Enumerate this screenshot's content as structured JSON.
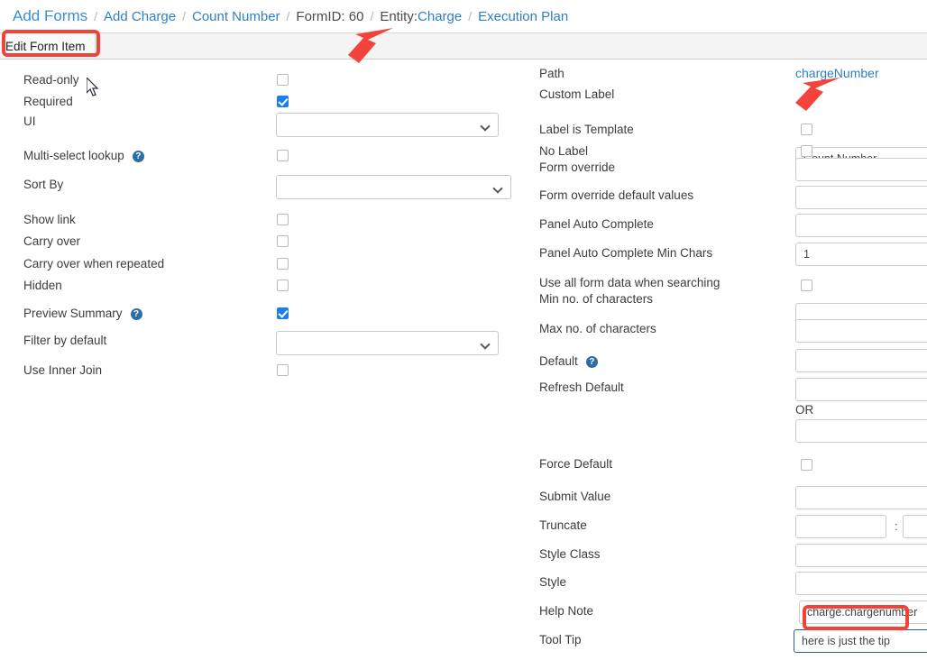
{
  "breadcrumb": {
    "items": [
      {
        "label": "Add Forms",
        "style": "big",
        "name": "breadcrumb-add-forms"
      },
      {
        "label": "Add Charge",
        "style": "link",
        "name": "breadcrumb-add-charge"
      },
      {
        "label": "Count Number",
        "style": "link",
        "name": "breadcrumb-count-number"
      },
      {
        "label": "FormID: 60",
        "style": "plain",
        "name": "breadcrumb-form-id"
      },
      {
        "label": "Entity:Charge",
        "style": "entity",
        "name": "breadcrumb-entity-charge",
        "prefix": "Entity:",
        "value": "Charge"
      },
      {
        "label": "Execution Plan",
        "style": "link",
        "name": "breadcrumb-execution-plan"
      }
    ],
    "separator": "/"
  },
  "tabs": [
    {
      "label": "Edit Form Item",
      "active": true,
      "name": "tab-edit-form-item"
    }
  ],
  "left_column": [
    {
      "label": "Read-only",
      "control": "checkbox",
      "checked": false,
      "name": "read-only"
    },
    {
      "label": "Required",
      "control": "checkbox",
      "checked": true,
      "name": "required"
    },
    {
      "label": "UI",
      "control": "select",
      "value": "",
      "name": "ui"
    },
    {
      "label": "Multi-select lookup",
      "control": "checkbox",
      "checked": false,
      "help": true,
      "name": "multi-select-lookup"
    },
    {
      "label": "Sort By",
      "control": "select",
      "value": "",
      "name": "sort-by"
    },
    {
      "label": "Show link",
      "control": "checkbox",
      "checked": false,
      "name": "show-link"
    },
    {
      "label": "Carry over",
      "control": "checkbox",
      "checked": false,
      "name": "carry-over"
    },
    {
      "label": "Carry over when repeated",
      "control": "checkbox",
      "checked": false,
      "name": "carry-over-when-repeated"
    },
    {
      "label": "Hidden",
      "control": "checkbox",
      "checked": false,
      "name": "hidden"
    },
    {
      "label": "Preview Summary",
      "control": "checkbox",
      "checked": true,
      "help": true,
      "name": "preview-summary"
    },
    {
      "label": "Filter by default",
      "control": "select",
      "value": "",
      "name": "filter-by-default"
    },
    {
      "label": "Use Inner Join",
      "control": "checkbox",
      "checked": false,
      "name": "use-inner-join"
    }
  ],
  "right_column": [
    {
      "label": "Path",
      "control": "link",
      "value": "chargeNumber",
      "name": "path"
    },
    {
      "label": "Custom Label",
      "control": "text",
      "value": "Count Number",
      "name": "custom-label"
    },
    {
      "label": "Label is Template",
      "control": "checkbox",
      "checked": false,
      "name": "label-is-template"
    },
    {
      "label": "No Label",
      "control": "checkbox",
      "checked": false,
      "name": "no-label"
    },
    {
      "label": "Form override",
      "control": "text",
      "value": "",
      "name": "form-override"
    },
    {
      "label": "Form override default values",
      "control": "text",
      "value": "",
      "name": "form-override-default-values"
    },
    {
      "label": "Panel Auto Complete",
      "control": "text",
      "value": "",
      "name": "panel-auto-complete"
    },
    {
      "label": "Panel Auto Complete Min Chars",
      "control": "text",
      "value": "1",
      "name": "panel-auto-complete-min-chars"
    },
    {
      "label": "Use all form data when searching",
      "control": "checkbox",
      "checked": false,
      "name": "use-all-form-data-when-searching"
    },
    {
      "label": "Min no. of characters",
      "control": "text",
      "value": "",
      "name": "min-no-of-characters"
    },
    {
      "label": "Max no. of characters",
      "control": "text",
      "value": "",
      "name": "max-no-of-characters"
    },
    {
      "label": "Default",
      "control": "text",
      "value": "",
      "help": true,
      "name": "default"
    },
    {
      "label": "Refresh Default",
      "control": "text",
      "value": "",
      "name": "refresh-default"
    },
    {
      "label": "Force Default",
      "control": "checkbox",
      "checked": false,
      "name": "force-default"
    },
    {
      "label": "Submit Value",
      "control": "text",
      "value": "",
      "name": "submit-value"
    },
    {
      "label": "Truncate",
      "control": "text-pair",
      "value": "",
      "value2": "",
      "separator": ":",
      "name": "truncate"
    },
    {
      "label": "Style Class",
      "control": "text",
      "value": "",
      "name": "style-class"
    },
    {
      "label": "Style",
      "control": "text",
      "value": "",
      "name": "style"
    },
    {
      "label": "Help Note",
      "control": "text",
      "value": "charge.chargenumber",
      "name": "help-note"
    },
    {
      "label": "Tool Tip",
      "control": "text",
      "value": "here is just the tip",
      "focused": true,
      "name": "tool-tip"
    }
  ],
  "static_labels": {
    "or": "OR",
    "truncate_separator": ":"
  },
  "colors": {
    "link": "#2f7fc1",
    "checkbox_checked": "#1a7ef0",
    "annotation": "#f44336",
    "focus_border": "#2a5d9c",
    "help_icon": "#2e6da4",
    "tab_bar": "#f4f4f4"
  }
}
